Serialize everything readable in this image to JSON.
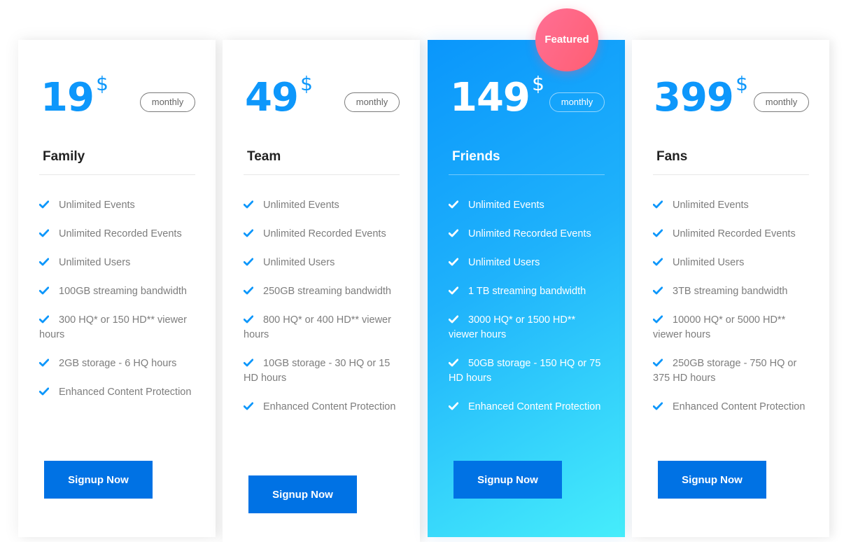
{
  "featured_badge": "Featured",
  "currency_symbol": "$",
  "colors": {
    "accent": "#0d97fb",
    "button": "#0072e4",
    "badge": "#ff6482",
    "featured_gradient_start": "#0a96fb",
    "featured_gradient_end": "#46edfb"
  },
  "plans": [
    {
      "price": "19",
      "period": "monthly",
      "name": "Family",
      "features": [
        "Unlimited Events",
        "Unlimited Recorded Events",
        "Unlimited Users",
        "100GB streaming bandwidth",
        "300 HQ* or 150 HD** viewer hours",
        "2GB storage - 6 HQ hours",
        "Enhanced Content Protection"
      ],
      "cta": "Signup Now"
    },
    {
      "price": "49",
      "period": "monthly",
      "name": "Team",
      "features": [
        "Unlimited Events",
        "Unlimited Recorded Events",
        "Unlimited Users",
        "250GB streaming bandwidth",
        "800 HQ* or 400 HD** viewer hours",
        "10GB storage - 30 HQ or 15 HD hours",
        "Enhanced Content Protection"
      ],
      "cta": "Signup Now"
    },
    {
      "price": "149",
      "period": "monthly",
      "name": "Friends",
      "featured": true,
      "features": [
        "Unlimited Events",
        "Unlimited Recorded Events",
        "Unlimited Users",
        "1 TB streaming bandwidth",
        "3000 HQ* or 1500 HD** viewer hours",
        "50GB storage - 150 HQ or 75 HD hours",
        "Enhanced Content Protection"
      ],
      "cta": "Signup Now"
    },
    {
      "price": "399",
      "period": "monthly",
      "name": "Fans",
      "features": [
        "Unlimited Events",
        "Unlimited Recorded Events",
        "Unlimited Users",
        "3TB streaming bandwidth",
        "10000 HQ* or 5000 HD** viewer hours",
        "250GB storage - 750 HQ or 375 HD hours",
        "Enhanced Content Protection"
      ],
      "cta": "Signup Now"
    }
  ]
}
